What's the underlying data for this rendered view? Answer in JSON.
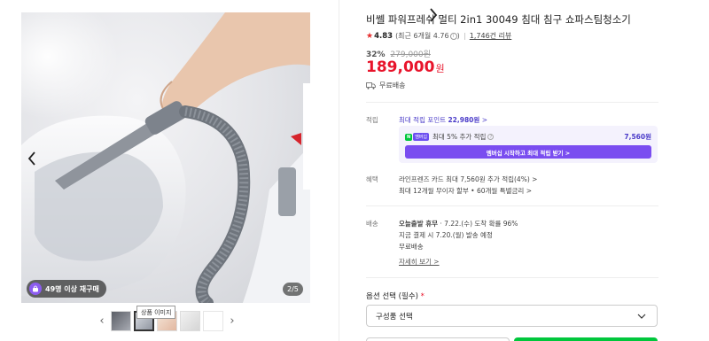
{
  "gallery": {
    "repurchase_badge": "49명 이상 재구매",
    "page_counter": "2/5",
    "tooltip": "상품 이미지",
    "icons": {
      "prev": "chevron-left-icon",
      "next": "chevron-right-icon",
      "badge": "shopping-bag-icon"
    }
  },
  "product": {
    "title": "비쎌 파워프레쉬 멀티 2in1 30049 침대 침구 쇼파스팀청소기",
    "rating": {
      "score": "4.83",
      "recent": "(최근 6개월 4.76",
      "recent_close": ")",
      "review_count": "1,746건 리뷰"
    },
    "discount_rate": "32%",
    "original_price": "279,000원",
    "sale_price": "189,000",
    "currency": "원",
    "shipping": "무료배송"
  },
  "points": {
    "label": "적립",
    "max_points_text": "최대 적립 포인트 ",
    "max_points_value": "22,980원",
    "member_badge_np": "N",
    "member_badge_plus": "멤버십",
    "member_text": "최대 5% 추가 적립",
    "member_amount": "7,560원",
    "member_button": "멤버십 시작하고 최대 적립 받기 >"
  },
  "benefits": {
    "label": "혜택",
    "line1": "라인프렌즈 카드 최대 7,560원 추가 적립(4%) >",
    "line2": "최대 12개월 무이자 할부 • 60개월 특별금리 >"
  },
  "delivery": {
    "label": "배송",
    "line1_bold": "오늘출발 휴무",
    "line1_rest": " · 7.22.(수) 도착 확률 96%",
    "line2": "지금 결제 시 7.20.(월) 발송 예정",
    "line3": "무료배송",
    "details_link": "자세히 보기 >"
  },
  "options": {
    "label": "옵션 선택 (필수)",
    "required_mark": "*",
    "select_value": "구성품 선택"
  },
  "colors": {
    "price_red": "#e8142b",
    "accent_purple": "#7a4df0",
    "naver_green": "#00c73c"
  }
}
